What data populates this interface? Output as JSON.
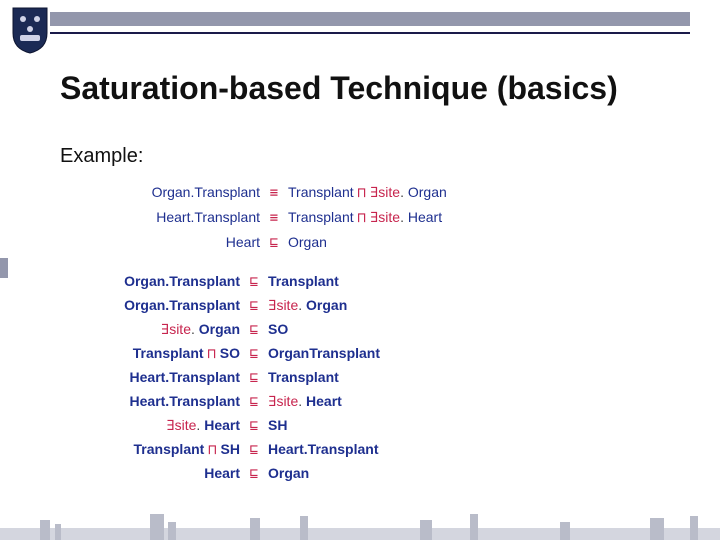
{
  "title": "Saturation-based Technique (basics)",
  "subtitle": "Example:",
  "sym": {
    "equiv": "≡",
    "sub": "⊑",
    "and": "⊓",
    "exists": "∃"
  },
  "c": {
    "OrganTransplant": "Organ.Transplant",
    "HeartTransplant": "Heart.Transplant",
    "Transplant": "Transplant",
    "Organ": "Organ",
    "Heart": "Heart",
    "OrganTransplant2": "OrganTransplant",
    "SO": "SO",
    "SH": "SH"
  },
  "r": {
    "site": "site"
  },
  "axioms_top": [
    {
      "lhs": {
        "type": "cls",
        "key": "OrganTransplant"
      },
      "op": "equiv",
      "rhs": [
        {
          "type": "cls",
          "key": "Transplant"
        },
        {
          "type": "op",
          "key": "and"
        },
        {
          "type": "exists"
        },
        {
          "type": "rel",
          "key": "site"
        },
        {
          "type": "dot"
        },
        {
          "type": "cls",
          "key": "Organ"
        }
      ]
    },
    {
      "lhs": {
        "type": "cls",
        "key": "HeartTransplant"
      },
      "op": "equiv",
      "rhs": [
        {
          "type": "cls",
          "key": "Transplant"
        },
        {
          "type": "op",
          "key": "and"
        },
        {
          "type": "exists"
        },
        {
          "type": "rel",
          "key": "site"
        },
        {
          "type": "dot"
        },
        {
          "type": "cls",
          "key": "Heart"
        }
      ]
    },
    {
      "lhs": {
        "type": "cls",
        "key": "Heart"
      },
      "op": "sub",
      "rhs": [
        {
          "type": "cls",
          "key": "Organ"
        }
      ]
    }
  ],
  "axioms_bottom": [
    {
      "lhs": [
        {
          "type": "nc",
          "key": "OrganTransplant"
        }
      ],
      "op": "sub",
      "rhs": [
        {
          "type": "nc",
          "key": "Transplant"
        }
      ]
    },
    {
      "lhs": [
        {
          "type": "nc",
          "key": "OrganTransplant"
        }
      ],
      "op": "sub",
      "rhs": [
        {
          "type": "exists"
        },
        {
          "type": "rel",
          "key": "site"
        },
        {
          "type": "dot"
        },
        {
          "type": "nc",
          "key": "Organ"
        }
      ]
    },
    {
      "lhs": [
        {
          "type": "exists"
        },
        {
          "type": "rel",
          "key": "site"
        },
        {
          "type": "dot"
        },
        {
          "type": "nc",
          "key": "Organ"
        }
      ],
      "op": "sub",
      "rhs": [
        {
          "type": "nc",
          "key": "SO"
        }
      ]
    },
    {
      "lhs": [
        {
          "type": "nc",
          "key": "Transplant"
        },
        {
          "type": "op",
          "key": "and"
        },
        {
          "type": "nc",
          "key": "SO"
        }
      ],
      "op": "sub",
      "rhs": [
        {
          "type": "nc",
          "key": "OrganTransplant2"
        }
      ]
    },
    {
      "lhs": [
        {
          "type": "nc",
          "key": "HeartTransplant"
        }
      ],
      "op": "sub",
      "rhs": [
        {
          "type": "nc",
          "key": "Transplant"
        }
      ]
    },
    {
      "lhs": [
        {
          "type": "nc",
          "key": "HeartTransplant"
        }
      ],
      "op": "sub",
      "rhs": [
        {
          "type": "exists"
        },
        {
          "type": "rel",
          "key": "site"
        },
        {
          "type": "dot"
        },
        {
          "type": "nc",
          "key": "Heart"
        }
      ]
    },
    {
      "lhs": [
        {
          "type": "exists"
        },
        {
          "type": "rel",
          "key": "site"
        },
        {
          "type": "dot"
        },
        {
          "type": "nc",
          "key": "Heart"
        }
      ],
      "op": "sub",
      "rhs": [
        {
          "type": "nc",
          "key": "SH"
        }
      ]
    },
    {
      "lhs": [
        {
          "type": "nc",
          "key": "Transplant"
        },
        {
          "type": "op",
          "key": "and"
        },
        {
          "type": "nc",
          "key": "SH"
        }
      ],
      "op": "sub",
      "rhs": [
        {
          "type": "nc",
          "key": "HeartTransplant"
        }
      ]
    },
    {
      "lhs": [
        {
          "type": "nc",
          "key": "Heart"
        }
      ],
      "op": "sub",
      "rhs": [
        {
          "type": "nc",
          "key": "Organ"
        }
      ]
    }
  ]
}
